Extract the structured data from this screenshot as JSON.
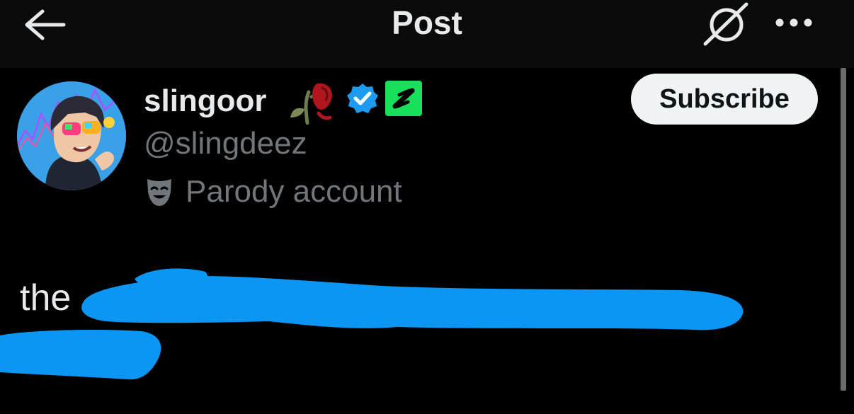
{
  "header": {
    "title": "Post",
    "back_icon": "arrow-left-icon",
    "grok_icon": "grok-icon",
    "more_icon": "more-dots-icon"
  },
  "author": {
    "name": "slingoor",
    "handle": "@slingdeez",
    "label": "Parody account",
    "badges": [
      "wilted-rose-emoji",
      "verified-icon",
      "affiliate-icon"
    ]
  },
  "subscribe": {
    "label": "Subscribe"
  },
  "post": {
    "visible_text": "the",
    "redaction_color": "#0a96f2"
  },
  "colors": {
    "background": "#000000",
    "primary_text": "#e7e9ea",
    "secondary_text": "#71767b",
    "verified": "#1d9bf0",
    "affiliate_bg": "#19e05a"
  }
}
